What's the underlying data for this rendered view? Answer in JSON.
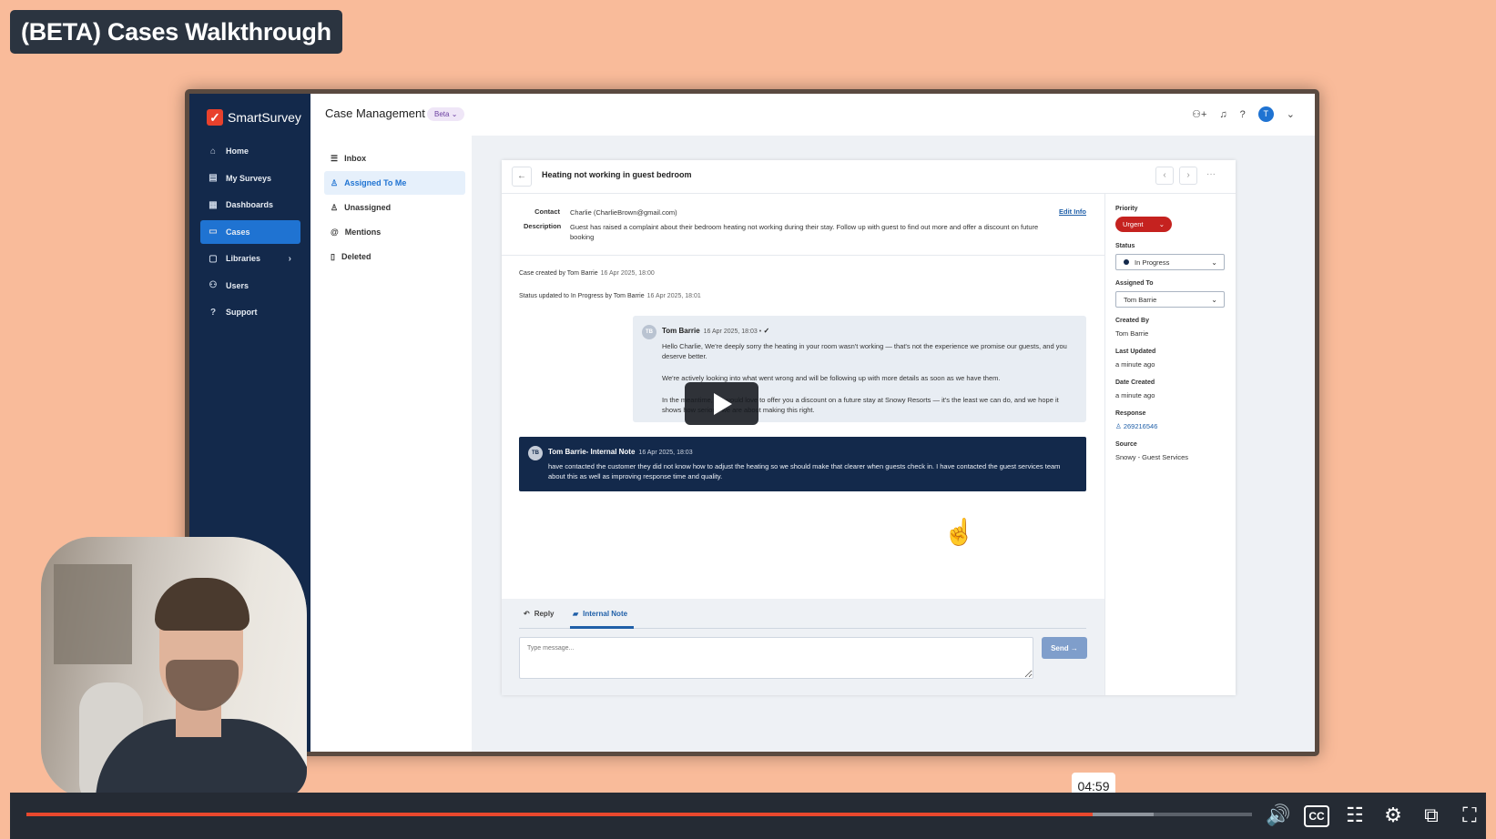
{
  "video": {
    "title": "(BETA) Cases Walkthrough",
    "time_tooltip": "04:59",
    "progress_percent": 87,
    "buffered_percent": 92
  },
  "app": {
    "brand": "SmartSurvey",
    "header": {
      "title": "Case Management",
      "badge": "Beta"
    },
    "sidebar": {
      "items": [
        {
          "label": "Home",
          "icon": "home-icon"
        },
        {
          "label": "My Surveys",
          "icon": "surveys-icon"
        },
        {
          "label": "Dashboards",
          "icon": "dashboard-icon"
        },
        {
          "label": "Cases",
          "icon": "cases-icon",
          "active": true
        },
        {
          "label": "Libraries",
          "icon": "folder-icon"
        },
        {
          "label": "Users",
          "icon": "users-icon"
        },
        {
          "label": "Support",
          "icon": "help-icon"
        }
      ]
    },
    "submenu": {
      "items": [
        {
          "label": "Inbox"
        },
        {
          "label": "Assigned To Me",
          "active": true
        },
        {
          "label": "Unassigned"
        },
        {
          "label": "Mentions"
        },
        {
          "label": "Deleted"
        }
      ]
    },
    "avatar_initial": "T"
  },
  "case": {
    "title": "Heating not working in guest bedroom",
    "contact_label": "Contact",
    "contact_value": "Charlie (CharlieBrown@gmail.com)",
    "description_label": "Description",
    "description_value": "Guest has raised a complaint about their bedroom heating not working during their stay. Follow up with guest to find out more and offer a discount on future booking",
    "edit_info": "Edit Info",
    "activity": [
      {
        "text": "Case created by Tom Barrie",
        "ts": "16 Apr 2025, 18:00"
      },
      {
        "text": "Status updated to In Progress by Tom Barrie",
        "ts": "16 Apr 2025, 18:01"
      }
    ],
    "message": {
      "initials": "TB",
      "author": "Tom Barrie",
      "ts": "16 Apr 2025, 18:03 •",
      "p1": "Hello Charlie, We're deeply sorry the heating in your room wasn't working — that's not the experience we promise our guests, and you deserve better.",
      "p2": "We're actively looking into what went wrong and will be following up with more details as soon as we have them.",
      "p3": "In the meantime, we would love to offer you a discount on a future stay at Snowy Resorts — it's the least we can do, and we hope it shows how serious we are about making this right."
    },
    "note": {
      "initials": "TB",
      "author": "Tom Barrie- Internal Note",
      "ts": "16 Apr 2025, 18:03",
      "body": "have contacted the customer they did not know how to adjust the heating so we should make that clearer when guests check in. I have contacted the guest services team about this as well as improving response time and quality."
    },
    "compose": {
      "reply_tab": "Reply",
      "note_tab": "Internal Note",
      "placeholder": "Type message...",
      "send": "Send"
    },
    "side": {
      "priority_label": "Priority",
      "priority_value": "Urgent",
      "status_label": "Status",
      "status_value": "In Progress",
      "assigned_label": "Assigned To",
      "assigned_value": "Tom Barrie",
      "created_by_label": "Created By",
      "created_by_value": "Tom Barrie",
      "last_updated_label": "Last Updated",
      "last_updated_value": "a minute ago",
      "date_created_label": "Date Created",
      "date_created_value": "a minute ago",
      "response_label": "Response",
      "response_value": "269216546",
      "source_label": "Source",
      "source_value": "Snowy - Guest Services"
    }
  }
}
